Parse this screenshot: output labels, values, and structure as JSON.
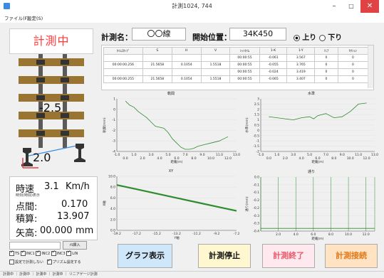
{
  "window": {
    "title": "計測1024, 744",
    "minimize": "–",
    "maximize": "□",
    "close": "✕"
  },
  "menu": [
    "ファイル(F)",
    "設定(S)"
  ],
  "status_display": "計測中",
  "measure": {
    "name_label": "計測名：",
    "name_value": "〇〇線",
    "start_label": "開始位置：",
    "start_value": "34K450",
    "up_label": "上り",
    "down_label": "下り",
    "direction": "up"
  },
  "gauge_value": "-2.5",
  "cant_value": "2.0",
  "table": {
    "headers": [
      "ﾀｲﾑｽﾀﾝﾌﾟ",
      "S",
      "H",
      "V",
      "ｼｯﾄﾀｲﾑ",
      "1-K",
      "1-Y",
      "ﾘﾆｱ",
      "ｾｸｼｮﾝ"
    ],
    "rows": [
      [
        "",
        "",
        "",
        "",
        "00:00:55",
        "-0.061",
        "3.567",
        "0",
        "0"
      ],
      [
        "00:00:00.256",
        "21.5658",
        "0.1054",
        "1.5518",
        "00:00:55",
        "-0.055",
        "3.765",
        "0",
        "0"
      ],
      [
        "",
        "",
        "",
        "",
        "00:00:55",
        "-0.024",
        "3.419",
        "0",
        "0"
      ],
      [
        "00:00:00.255",
        "21.5658",
        "0.1054",
        "1.5518",
        "00:00:55",
        "-0.065",
        "3.407",
        "0",
        "0"
      ]
    ]
  },
  "readouts": {
    "speed_label": "時速",
    "speed_value": "3.1",
    "speed_unit": "Km/h",
    "speed_sub": "時刻(時間)表示",
    "point_label": "点間:",
    "point_value": "0.170",
    "total_label": "積算:",
    "total_value": "13.907",
    "sag_label": "矢高:",
    "sag_value": "00.000",
    "sag_unit": "mm",
    "insert_button": "ﾒﾓ挿入"
  },
  "checkboxes": [
    {
      "label": "TS",
      "checked": true
    },
    {
      "label": "INC1",
      "checked": true
    },
    {
      "label": "INC2",
      "checked": true
    },
    {
      "label": "INC3",
      "checked": true
    },
    {
      "label": "LIN",
      "checked": true
    }
  ],
  "checkboxes2": [
    {
      "label": "設定で計測しない",
      "checked": false
    },
    {
      "label": "プリズム設定する",
      "checked": true
    }
  ],
  "buttons": {
    "graph": "グラフ表示",
    "stop": "計測停止",
    "end": "計測終了",
    "connect": "計測接続"
  },
  "statusbar": "計測中 ｜ 計測中 ｜ 計測中 ｜ 計測中 ｜ リニアゲージ計測",
  "colors": {
    "red": "#ff3b3b",
    "graph_bg": "#cfe7fb",
    "stop_bg": "#fff7cf",
    "end_bg": "#ffe9ef",
    "connect_bg": "#ffe3c2",
    "line": "#2e8b2e"
  },
  "chart_data": [
    {
      "type": "line",
      "title": "軌間",
      "xlabel": "距離(m)",
      "ylabel": "軌間(mm)",
      "xlim": [
        -1.0,
        13.0
      ],
      "ylim": [
        -4,
        1
      ],
      "xticks_top": [
        "-1.0",
        "1.0",
        "3.0",
        "5.0",
        "7.0",
        "9.0",
        "11.0",
        "13.0"
      ],
      "xticks_bottom": [
        "0.0",
        "2.0",
        "4.0",
        "6.0",
        "8.0",
        "10.0",
        "12.0"
      ],
      "yticks": [
        "1",
        "0",
        "-1",
        "-2",
        "-3",
        "-4"
      ],
      "x": [
        0,
        0.5,
        1,
        1.5,
        2,
        2.5,
        3,
        3.5,
        4,
        4.5,
        5,
        5.5,
        6,
        6.5,
        7,
        7.5,
        8,
        8.5,
        9,
        9.5,
        10,
        10.5,
        11,
        11.5,
        12
      ],
      "y": [
        0.8,
        0.4,
        0.2,
        -0.2,
        -0.5,
        -0.8,
        -1.2,
        -1.6,
        -1.7,
        -1.8,
        -2.2,
        -2.8,
        -3.2,
        -3.6,
        -3.8,
        -3.8,
        -3.7,
        -3.5,
        -3.4,
        -3.3,
        -3.2,
        -3.1,
        -3.0,
        -2.8,
        -2.6
      ]
    },
    {
      "type": "line",
      "title": "水準",
      "xlabel": "距離(m)",
      "ylabel": "水準(mm)",
      "xlim": [
        -1.0,
        13.0
      ],
      "ylim": [
        -2,
        3
      ],
      "xticks_top": [
        "-1.0",
        "1.0",
        "3.0",
        "5.0",
        "7.0",
        "9.0",
        "11.0",
        "13.0"
      ],
      "xticks_bottom": [
        "0.0",
        "2.0",
        "4.0",
        "6.0",
        "8.0",
        "10.0",
        "12.0"
      ],
      "yticks": [
        "3",
        "2.5",
        "2",
        "1.5",
        "1",
        "0.5",
        "0",
        "-0.5",
        "-1",
        "-1.5",
        "-2"
      ],
      "x": [
        0,
        1,
        2,
        3,
        4,
        5,
        5.5,
        6,
        7,
        8,
        9,
        10,
        11,
        12
      ],
      "y": [
        1.3,
        1.2,
        1.1,
        1.0,
        1.2,
        1.3,
        1.1,
        1.4,
        1.6,
        1.2,
        1.3,
        1.8,
        2.5,
        2.6
      ]
    },
    {
      "type": "line",
      "title": "XY",
      "xlabel": "Y軸",
      "ylabel": "X軸",
      "xlim": [
        -19.2,
        -7.2
      ],
      "ylim": [
        0,
        10
      ],
      "xticks": [
        "-19.2",
        "-17.2",
        "-15.2",
        "-13.2",
        "-11.2",
        "-9.2",
        "-7.2"
      ],
      "yticks": [
        "10.0",
        "8.0",
        "6.0",
        "4.0",
        "2.0",
        "0.0"
      ],
      "x": [
        -19.2,
        -17.2,
        -15.2,
        -13.2,
        -11.2,
        -9.2,
        -7.2
      ],
      "y": [
        8.4,
        7.6,
        6.8,
        6.0,
        5.2,
        4.4,
        3.6
      ]
    },
    {
      "type": "line",
      "title": "通り",
      "xlabel": "距離(m)",
      "ylabel": "通り(mm)",
      "xlim": [
        0,
        13
      ],
      "ylim": [
        -0.4,
        0.0
      ],
      "xticks": [
        "2.0",
        "4.0",
        "6.0",
        "8.0",
        "10.0",
        "12.0"
      ],
      "yticks": [
        "0.0",
        "-0.1",
        "-0.1",
        "-0.2",
        "-0.2",
        "-0.3",
        "-0.3",
        "-0.4"
      ],
      "x": [
        0,
        2,
        4,
        6,
        8,
        10,
        12,
        13
      ],
      "y": [
        -0.38,
        -0.38,
        -0.38,
        -0.38,
        -0.38,
        -0.38,
        -0.38,
        -0.38
      ]
    }
  ]
}
